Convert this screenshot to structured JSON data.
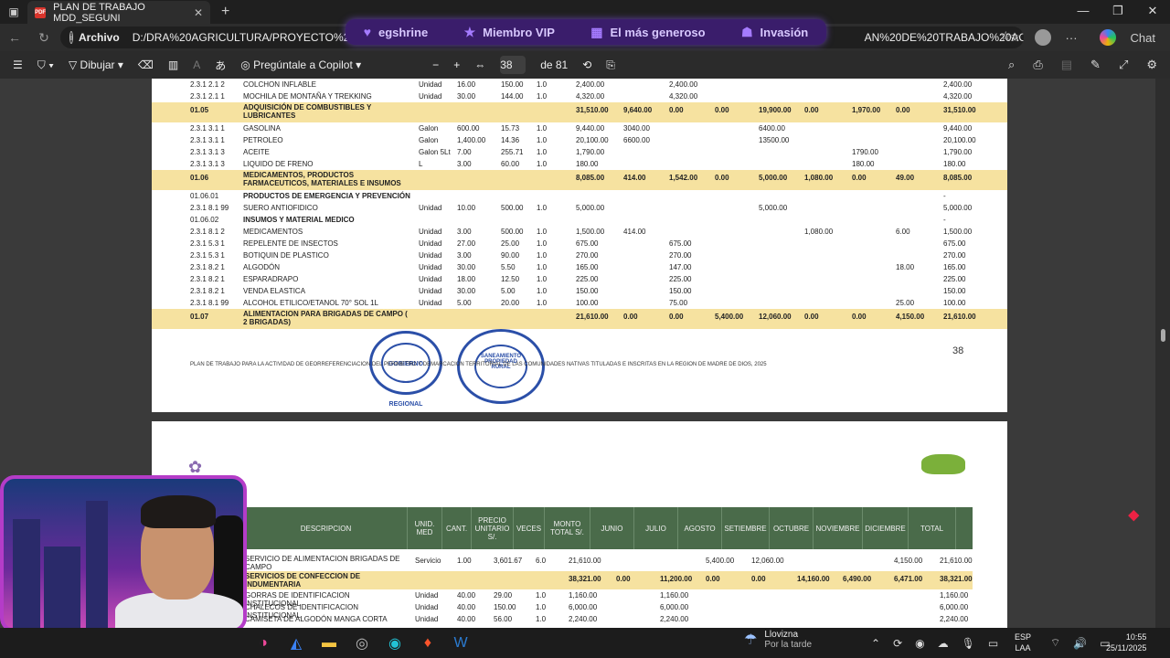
{
  "browser": {
    "tab_title": "PLAN DE TRABAJO MDD_SEGUNI",
    "origin_label": "Archivo",
    "url_left": "D:/DRA%20AGRICULTURA/PROYECTO%20GEO",
    "url_right": "AN%20DE%20TRABAJO%20ACTU...",
    "chat_label": "Chat"
  },
  "overlay": {
    "items": [
      "egshrine",
      "Miembro VIP",
      "El más generoso",
      "Invasión"
    ]
  },
  "pdf_toolbar": {
    "draw_label": "Dibujar",
    "copilot_label": "Pregúntale a Copilot",
    "page_current": "38",
    "page_total": "de 81"
  },
  "page1": {
    "rows": [
      {
        "code": "2.3.1 2.1 2",
        "desc": "COLCHON INFLABLE",
        "unit": "Unidad",
        "qty": "16.00",
        "price": "150.00",
        "times": "1.0",
        "total": "2,400.00",
        "c1": "",
        "c2": "2,400.00",
        "c3": "",
        "c4": "",
        "c5": "",
        "c6": "",
        "c7": "",
        "grand": "2,400.00",
        "band": false,
        "bold": false
      },
      {
        "code": "2.3.1 2.1 1",
        "desc": "MOCHILA DE MONTAÑA Y TREKKING",
        "unit": "Unidad",
        "qty": "30.00",
        "price": "144.00",
        "times": "1.0",
        "total": "4,320.00",
        "c1": "",
        "c2": "4,320.00",
        "c3": "",
        "c4": "",
        "c5": "",
        "c6": "",
        "c7": "",
        "grand": "4,320.00",
        "band": false,
        "bold": false
      },
      {
        "code": "01.05",
        "desc": "ADQUISICIÓN DE COMBUSTIBLES Y LUBRICANTES",
        "unit": "",
        "qty": "",
        "price": "",
        "times": "",
        "total": "31,510.00",
        "c1": "9,640.00",
        "c2": "0.00",
        "c3": "0.00",
        "c4": "19,900.00",
        "c5": "0.00",
        "c6": "1,970.00",
        "c7": "0.00",
        "grand": "31,510.00",
        "band": true,
        "bold": true
      },
      {
        "code": "2.3.1 3.1 1",
        "desc": "GASOLINA",
        "unit": "Galon",
        "qty": "600.00",
        "price": "15.73",
        "times": "1.0",
        "total": "9,440.00",
        "c1": "3040.00",
        "c2": "",
        "c3": "",
        "c4": "6400.00",
        "c5": "",
        "c6": "",
        "c7": "",
        "grand": "9,440.00",
        "band": false,
        "bold": false
      },
      {
        "code": "2.3.1 3.1 1",
        "desc": "PETROLEO",
        "unit": "Galon",
        "qty": "1,400.00",
        "price": "14.36",
        "times": "1.0",
        "total": "20,100.00",
        "c1": "6600.00",
        "c2": "",
        "c3": "",
        "c4": "13500.00",
        "c5": "",
        "c6": "",
        "c7": "",
        "grand": "20,100.00",
        "band": false,
        "bold": false
      },
      {
        "code": "2.3.1 3.1 3",
        "desc": "ACEITE",
        "unit": "Galon 5Lt",
        "qty": "7.00",
        "price": "255.71",
        "times": "1.0",
        "total": "1,790.00",
        "c1": "",
        "c2": "",
        "c3": "",
        "c4": "",
        "c5": "",
        "c6": "1790.00",
        "c7": "",
        "grand": "1,790.00",
        "band": false,
        "bold": false
      },
      {
        "code": "2.3.1 3.1 3",
        "desc": "LIQUIDO DE FRENO",
        "unit": "L",
        "qty": "3.00",
        "price": "60.00",
        "times": "1.0",
        "total": "180.00",
        "c1": "",
        "c2": "",
        "c3": "",
        "c4": "",
        "c5": "",
        "c6": "180.00",
        "c7": "",
        "grand": "180.00",
        "band": false,
        "bold": false
      },
      {
        "code": "01.06",
        "desc": "MEDICAMENTOS, PRODUCTOS FARMACEUTICOS, MATERIALES E INSUMOS",
        "unit": "",
        "qty": "",
        "price": "",
        "times": "",
        "total": "8,085.00",
        "c1": "414.00",
        "c2": "1,542.00",
        "c3": "0.00",
        "c4": "5,000.00",
        "c5": "1,080.00",
        "c6": "0.00",
        "c7": "49.00",
        "grand": "8,085.00",
        "band": true,
        "bold": true
      },
      {
        "code": "01.06.01",
        "desc": "PRODUCTOS DE EMERGENCIA Y PREVENCIÓN",
        "unit": "",
        "qty": "",
        "price": "",
        "times": "",
        "total": "",
        "c1": "",
        "c2": "",
        "c3": "",
        "c4": "",
        "c5": "",
        "c6": "",
        "c7": "",
        "grand": "-",
        "band": false,
        "bold": true
      },
      {
        "code": "2.3.1 8.1 99",
        "desc": "SUERO ANTIOFIDICO",
        "unit": "Unidad",
        "qty": "10.00",
        "price": "500.00",
        "times": "1.0",
        "total": "5,000.00",
        "c1": "",
        "c2": "",
        "c3": "",
        "c4": "5,000.00",
        "c5": "",
        "c6": "",
        "c7": "",
        "grand": "5,000.00",
        "band": false,
        "bold": false
      },
      {
        "code": "01.06.02",
        "desc": "INSUMOS Y MATERIAL MEDICO",
        "unit": "",
        "qty": "",
        "price": "",
        "times": "",
        "total": "",
        "c1": "",
        "c2": "",
        "c3": "",
        "c4": "",
        "c5": "",
        "c6": "",
        "c7": "",
        "grand": "-",
        "band": false,
        "bold": true
      },
      {
        "code": "2.3.1 8.1 2",
        "desc": "MEDICAMENTOS",
        "unit": "Unidad",
        "qty": "3.00",
        "price": "500.00",
        "times": "1.0",
        "total": "1,500.00",
        "c1": "414.00",
        "c2": "",
        "c3": "",
        "c4": "",
        "c5": "1,080.00",
        "c6": "",
        "c7": "6.00",
        "grand": "1,500.00",
        "band": false,
        "bold": false
      },
      {
        "code": "2.3.1 5.3 1",
        "desc": "REPELENTE DE INSECTOS",
        "unit": "Unidad",
        "qty": "27.00",
        "price": "25.00",
        "times": "1.0",
        "total": "675.00",
        "c1": "",
        "c2": "675.00",
        "c3": "",
        "c4": "",
        "c5": "",
        "c6": "",
        "c7": "",
        "grand": "675.00",
        "band": false,
        "bold": false
      },
      {
        "code": "2.3.1 5.3 1",
        "desc": "BOTIQUIN DE PLASTICO",
        "unit": "Unidad",
        "qty": "3.00",
        "price": "90.00",
        "times": "1.0",
        "total": "270.00",
        "c1": "",
        "c2": "270.00",
        "c3": "",
        "c4": "",
        "c5": "",
        "c6": "",
        "c7": "",
        "grand": "270.00",
        "band": false,
        "bold": false
      },
      {
        "code": "2.3.1 8.2 1",
        "desc": "ALGODÓN",
        "unit": "Unidad",
        "qty": "30.00",
        "price": "5.50",
        "times": "1.0",
        "total": "165.00",
        "c1": "",
        "c2": "147.00",
        "c3": "",
        "c4": "",
        "c5": "",
        "c6": "",
        "c7": "18.00",
        "grand": "165.00",
        "band": false,
        "bold": false
      },
      {
        "code": "2.3.1 8.2 1",
        "desc": "ESPARADRAPO",
        "unit": "Unidad",
        "qty": "18.00",
        "price": "12.50",
        "times": "1.0",
        "total": "225.00",
        "c1": "",
        "c2": "225.00",
        "c3": "",
        "c4": "",
        "c5": "",
        "c6": "",
        "c7": "",
        "grand": "225.00",
        "band": false,
        "bold": false
      },
      {
        "code": "2.3.1 8.2 1",
        "desc": "VENDA ELASTICA",
        "unit": "Unidad",
        "qty": "30.00",
        "price": "5.00",
        "times": "1.0",
        "total": "150.00",
        "c1": "",
        "c2": "150.00",
        "c3": "",
        "c4": "",
        "c5": "",
        "c6": "",
        "c7": "",
        "grand": "150.00",
        "band": false,
        "bold": false
      },
      {
        "code": "2.3.1 8.1 99",
        "desc": "ALCOHOL ETILICO/ETANOL 70° SOL 1L",
        "unit": "Unidad",
        "qty": "5.00",
        "price": "20.00",
        "times": "1.0",
        "total": "100.00",
        "c1": "",
        "c2": "75.00",
        "c3": "",
        "c4": "",
        "c5": "",
        "c6": "",
        "c7": "25.00",
        "grand": "100.00",
        "band": false,
        "bold": false
      },
      {
        "code": "01.07",
        "desc": "ALIMENTACION PARA BRIGADAS DE CAMPO ( 2 BRIGADAS)",
        "unit": "",
        "qty": "",
        "price": "",
        "times": "",
        "total": "21,610.00",
        "c1": "0.00",
        "c2": "0.00",
        "c3": "5,400.00",
        "c4": "12,060.00",
        "c5": "0.00",
        "c6": "0.00",
        "c7": "4,150.00",
        "grand": "21,610.00",
        "band": true,
        "bold": true
      }
    ],
    "footer": "PLAN DE TRABAJO PARA LA ACTIVIDAD DE GEORREFERENCIACION DEL PERIMETRO Y DEMARCACION TERRITORIAL DE LAS COMUNIDADES NATIVAS TITULADAS E INSCRITAS EN LA REGION DE MADRE DE DIOS, 2025",
    "page_number": "38",
    "seal1_text": "GOBIERNO REGIONAL",
    "seal2_text": "SANEAMIENTO PROPIEDAD RURAL"
  },
  "page2": {
    "headers": [
      "DESCRIPCION",
      "UNID. MED",
      "CANT.",
      "PRECIO UNITARIO S/.",
      "VECES",
      "MONTO TOTAL S/.",
      "JUNIO",
      "JULIO",
      "AGOSTO",
      "SETIEMBRE",
      "OCTUBRE",
      "NOVIEMBRE",
      "DICIEMBRE",
      "TOTAL"
    ],
    "rows": [
      {
        "desc": "SERVICIO DE ALIMENTACION BRIGADAS DE CAMPO",
        "unit": "Servicio",
        "qty": "1.00",
        "price": "3,601.67",
        "times": "6.0",
        "total": "21,610.00",
        "jun": "",
        "jul": "",
        "ago": "5,400.00",
        "set": "12,060.00",
        "oct": "",
        "nov": "",
        "dic": "4,150.00",
        "grand": "21,610.00",
        "band": false
      },
      {
        "desc": "SERVICIOS DE CONFECCION DE INDUMENTARIA",
        "unit": "",
        "qty": "",
        "price": "",
        "times": "",
        "total": "38,321.00",
        "jun": "0.00",
        "jul": "11,200.00",
        "ago": "0.00",
        "set": "0.00",
        "oct": "14,160.00",
        "nov": "6,490.00",
        "dic": "6,471.00",
        "grand": "38,321.00",
        "band": true
      },
      {
        "desc": "GORRAS DE IDENTIFICACION INSTITUCIONAL",
        "unit": "Unidad",
        "qty": "40.00",
        "price": "29.00",
        "times": "1.0",
        "total": "1,160.00",
        "jun": "",
        "jul": "1,160.00",
        "ago": "",
        "set": "",
        "oct": "",
        "nov": "",
        "dic": "",
        "grand": "1,160.00",
        "band": false
      },
      {
        "desc": "CHALECOS DE IDENTIFICACION INSTITUCIONAL",
        "unit": "Unidad",
        "qty": "40.00",
        "price": "150.00",
        "times": "1.0",
        "total": "6,000.00",
        "jun": "",
        "jul": "6,000.00",
        "ago": "",
        "set": "",
        "oct": "",
        "nov": "",
        "dic": "",
        "grand": "6,000.00",
        "band": false
      },
      {
        "desc": "CAMISETA DE ALGODÓN MANGA CORTA",
        "unit": "Unidad",
        "qty": "40.00",
        "price": "56.00",
        "times": "1.0",
        "total": "2,240.00",
        "jun": "",
        "jul": "2,240.00",
        "ago": "",
        "set": "",
        "oct": "",
        "nov": "",
        "dic": "",
        "grand": "2,240.00",
        "band": false
      }
    ]
  },
  "taskbar": {
    "weather_title": "Llovizna",
    "weather_sub": "Por la tarde",
    "lang_top": "ESP",
    "lang_bottom": "LAA",
    "time": "10:55",
    "date": "25/11/2025"
  }
}
